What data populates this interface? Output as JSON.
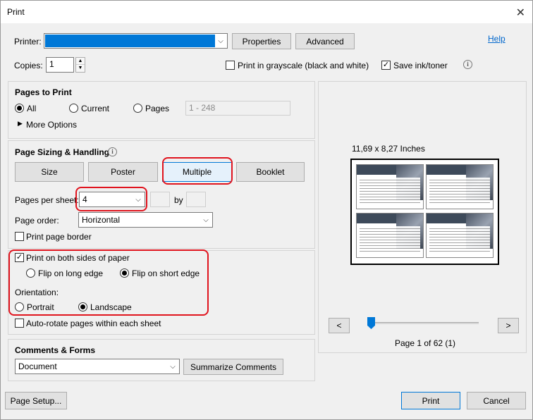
{
  "window": {
    "title": "Print",
    "close_glyph": "✕"
  },
  "top": {
    "printer_label": "Printer:",
    "printer_value": "",
    "properties_label": "Properties",
    "advanced_label": "Advanced",
    "help_label": "Help",
    "copies_label": "Copies:",
    "copies_value": "1",
    "grayscale_label": "Print in grayscale (black and white)",
    "grayscale_checked": false,
    "save_ink_label": "Save ink/toner",
    "save_ink_checked": true
  },
  "pages_to_print": {
    "heading": "Pages to Print",
    "all_label": "All",
    "current_label": "Current",
    "pages_label": "Pages",
    "pages_range": "1 - 248",
    "more_options_label": "More Options",
    "selected": "all"
  },
  "page_sizing": {
    "heading": "Page Sizing & Handling",
    "tabs": [
      "Size",
      "Poster",
      "Multiple",
      "Booklet"
    ],
    "selected_tab": "Multiple",
    "pages_per_sheet_label": "Pages per sheet:",
    "pages_per_sheet_value": "4",
    "by_label": "by",
    "page_order_label": "Page order:",
    "page_order_value": "Horizontal",
    "print_border_label": "Print page border",
    "print_border_checked": false
  },
  "duplex": {
    "both_sides_label": "Print on both sides of paper",
    "both_sides_checked": true,
    "flip_long_label": "Flip on long edge",
    "flip_short_label": "Flip on short edge",
    "flip_selected": "short",
    "orientation_label": "Orientation:",
    "portrait_label": "Portrait",
    "landscape_label": "Landscape",
    "orientation_selected": "landscape",
    "auto_rotate_label": "Auto-rotate pages within each sheet",
    "auto_rotate_checked": false
  },
  "comments": {
    "heading": "Comments & Forms",
    "value": "Document",
    "summarize_label": "Summarize Comments"
  },
  "preview": {
    "size_label": "11,69 x 8,27 Inches",
    "prev_glyph": "<",
    "next_glyph": ">",
    "page_label": "Page 1 of 62 (1)",
    "slider_fraction": 0.0
  },
  "bottom": {
    "page_setup_label": "Page Setup...",
    "print_label": "Print",
    "cancel_label": "Cancel"
  },
  "colors": {
    "highlight_red": "#e0141e",
    "selection_blue": "#0078d7",
    "link_blue": "#0066cc"
  }
}
